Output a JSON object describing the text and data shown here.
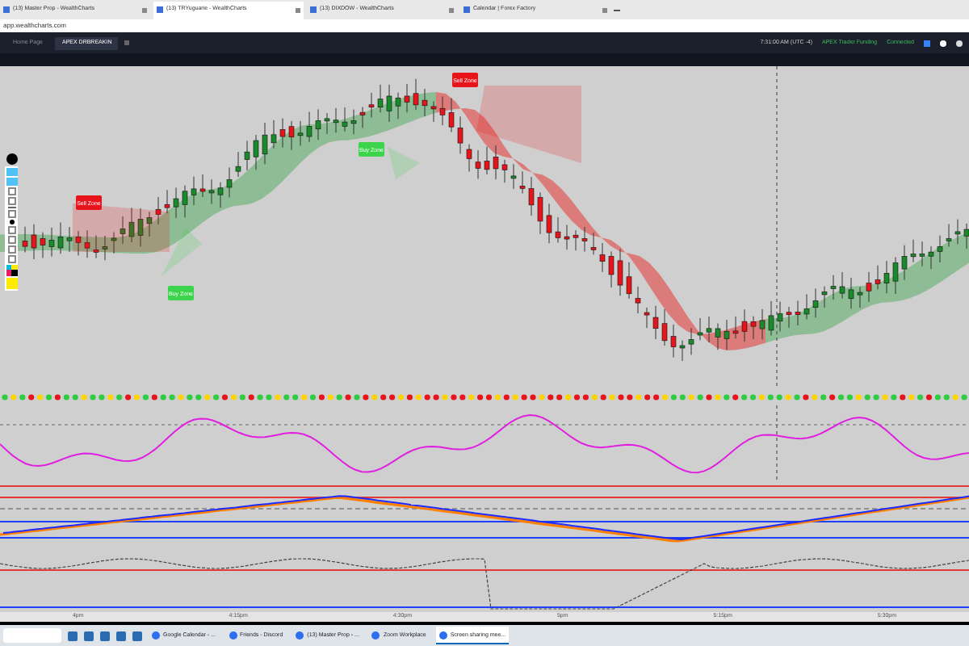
{
  "browser_tabs": [
    {
      "title": "(13) Master Prop - WealthCharts",
      "selected": false
    },
    {
      "title": "(13) TRYuguarie - WealthCharts",
      "selected": true
    },
    {
      "title": "(13) DIXDOW - WealthCharts",
      "selected": false
    },
    {
      "title": "Calendar | Forex Factory",
      "selected": false
    }
  ],
  "address_bar": {
    "url": "app.wealthcharts.com"
  },
  "app_tabs": [
    {
      "label": "Home Page",
      "selected": false
    },
    {
      "label": "APEX DRBREAKIN",
      "selected": true
    }
  ],
  "status": {
    "time": "7:31:00 AM  (UTC -4)",
    "account": "APEX Trader Funding",
    "connection": "Connected"
  },
  "zones": [
    {
      "kind": "sell",
      "label": "Sell Zone"
    },
    {
      "kind": "buy",
      "label": "Buy Zone"
    },
    {
      "kind": "sell",
      "label": "Sell Zone"
    },
    {
      "kind": "buy",
      "label": "Buy Zone"
    }
  ],
  "time_axis": [
    "4pm",
    "4:15pm",
    "4:30pm",
    "5pm",
    "5:15pm",
    "5:30pm"
  ],
  "taskbar": {
    "items": [
      {
        "label": "Google Calendar - ...",
        "selected": false
      },
      {
        "label": "Friends - Discord",
        "selected": false
      },
      {
        "label": "(13) Master Prop - ...",
        "selected": false
      },
      {
        "label": "Zoom Workplace",
        "selected": false
      },
      {
        "label": "Screen sharing mee...",
        "selected": true
      }
    ]
  }
}
